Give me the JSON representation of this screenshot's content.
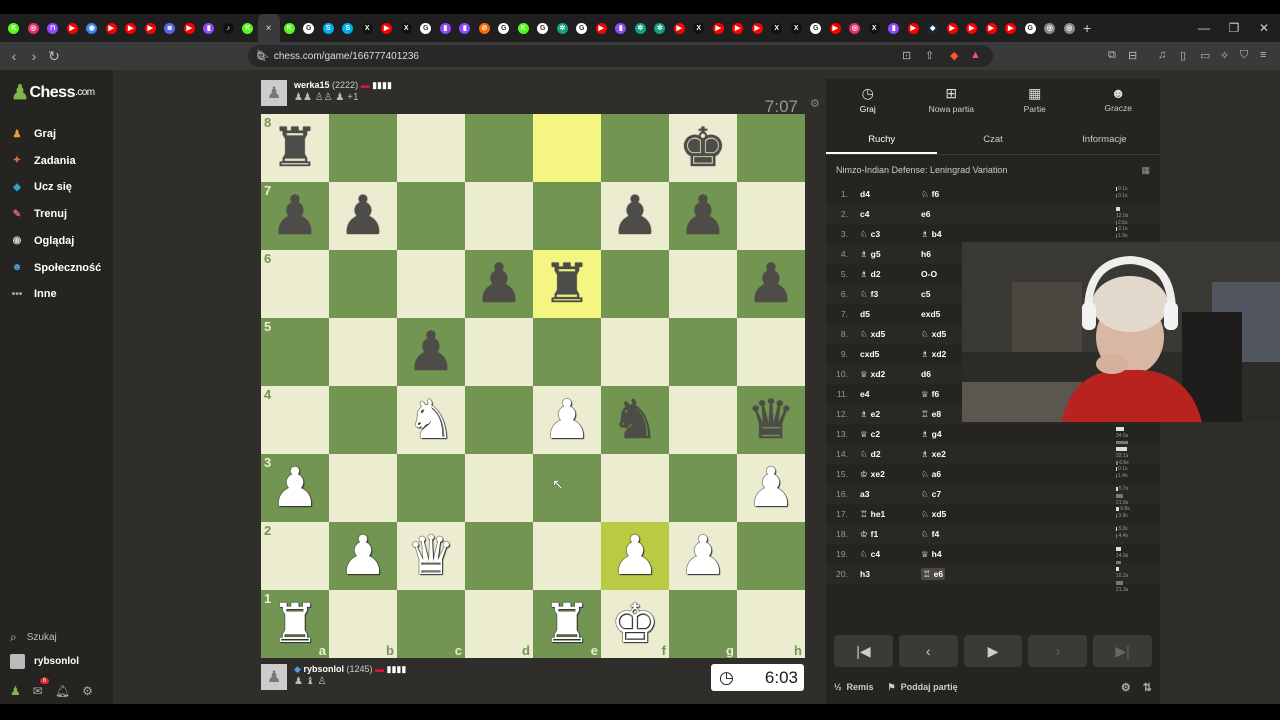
{
  "browser": {
    "url": "chess.com/game/166777401236",
    "tab_favicons": [
      {
        "icon": "kick-icon",
        "color": "#53fc18",
        "glyph": "K"
      },
      {
        "icon": "instagram-icon",
        "color": "#e1306c",
        "glyph": "◎"
      },
      {
        "icon": "twitch-icon",
        "color": "#9146ff",
        "glyph": "⊓"
      },
      {
        "icon": "youtube-icon",
        "color": "#ff0000",
        "glyph": "▶"
      },
      {
        "icon": "site-icon",
        "color": "#3b82f6",
        "glyph": "◉"
      },
      {
        "icon": "youtube-icon",
        "color": "#ff0000",
        "glyph": "▶"
      },
      {
        "icon": "youtube-icon",
        "color": "#ff0000",
        "glyph": "▶"
      },
      {
        "icon": "youtube-icon",
        "color": "#ff0000",
        "glyph": "▶"
      },
      {
        "icon": "discord-icon",
        "color": "#5865f2",
        "glyph": "◙"
      },
      {
        "icon": "youtube-icon",
        "color": "#ff0000",
        "glyph": "▶"
      },
      {
        "icon": "twitch-icon",
        "color": "#9146ff",
        "glyph": "▮"
      },
      {
        "icon": "tiktok-icon",
        "color": "#111111",
        "glyph": "♪"
      },
      {
        "icon": "kick-icon",
        "color": "#53fc18",
        "glyph": "K"
      },
      {
        "icon": "close-icon",
        "color": "",
        "glyph": "×"
      },
      {
        "icon": "kick-icon",
        "color": "#53fc18",
        "glyph": "K"
      },
      {
        "icon": "google-icon",
        "color": "#ffffff",
        "glyph": "G"
      },
      {
        "icon": "skype-icon",
        "color": "#00aff0",
        "glyph": "S"
      },
      {
        "icon": "skype-icon",
        "color": "#00aff0",
        "glyph": "S"
      },
      {
        "icon": "x-icon",
        "color": "#111111",
        "glyph": "X"
      },
      {
        "icon": "youtube-icon",
        "color": "#ff0000",
        "glyph": "▶"
      },
      {
        "icon": "x-icon",
        "color": "#111111",
        "glyph": "X"
      },
      {
        "icon": "google-icon",
        "color": "#ffffff",
        "glyph": "G"
      },
      {
        "icon": "twitch-icon",
        "color": "#9146ff",
        "glyph": "▮"
      },
      {
        "icon": "twitch-icon",
        "color": "#9146ff",
        "glyph": "▮"
      },
      {
        "icon": "bookmark-icon",
        "color": "#ff6a00",
        "glyph": "⊘"
      },
      {
        "icon": "google-icon",
        "color": "#ffffff",
        "glyph": "G"
      },
      {
        "icon": "kick-icon",
        "color": "#53fc18",
        "glyph": "K"
      },
      {
        "icon": "google-icon",
        "color": "#ffffff",
        "glyph": "G"
      },
      {
        "icon": "chatgpt-icon",
        "color": "#10a37f",
        "glyph": "✲"
      },
      {
        "icon": "google-icon",
        "color": "#ffffff",
        "glyph": "G"
      },
      {
        "icon": "youtube-icon",
        "color": "#ff0000",
        "glyph": "▶"
      },
      {
        "icon": "twitch-icon",
        "color": "#9146ff",
        "glyph": "▮"
      },
      {
        "icon": "chatgpt-icon",
        "color": "#10a37f",
        "glyph": "✲"
      },
      {
        "icon": "chatgpt-icon",
        "color": "#10a37f",
        "glyph": "✲"
      },
      {
        "icon": "youtube-icon",
        "color": "#ff0000",
        "glyph": "▶"
      },
      {
        "icon": "x-icon",
        "color": "#111111",
        "glyph": "X"
      },
      {
        "icon": "youtube-icon",
        "color": "#ff0000",
        "glyph": "▶"
      },
      {
        "icon": "youtube-icon",
        "color": "#ff0000",
        "glyph": "▶"
      },
      {
        "icon": "youtube-icon",
        "color": "#ff0000",
        "glyph": "▶"
      },
      {
        "icon": "x-icon",
        "color": "#111111",
        "glyph": "X"
      },
      {
        "icon": "x-icon",
        "color": "#111111",
        "glyph": "X"
      },
      {
        "icon": "google-icon",
        "color": "#ffffff",
        "glyph": "G"
      },
      {
        "icon": "youtube-icon",
        "color": "#ff0000",
        "glyph": "▶"
      },
      {
        "icon": "instagram-icon",
        "color": "#e1306c",
        "glyph": "◎"
      },
      {
        "icon": "x-icon",
        "color": "#111111",
        "glyph": "X"
      },
      {
        "icon": "twitch-icon",
        "color": "#9146ff",
        "glyph": "▮"
      },
      {
        "icon": "youtube-icon",
        "color": "#ff0000",
        "glyph": "▶"
      },
      {
        "icon": "steam-icon",
        "color": "#1b2838",
        "glyph": "◆"
      },
      {
        "icon": "youtube-icon",
        "color": "#ff0000",
        "glyph": "▶"
      },
      {
        "icon": "youtube-icon",
        "color": "#ff0000",
        "glyph": "▶"
      },
      {
        "icon": "youtube-icon",
        "color": "#ff0000",
        "glyph": "▶"
      },
      {
        "icon": "youtube-icon",
        "color": "#ff0000",
        "glyph": "▶"
      },
      {
        "icon": "google-icon",
        "color": "#ffffff",
        "glyph": "G"
      },
      {
        "icon": "globe-icon",
        "color": "#888888",
        "glyph": "◎"
      },
      {
        "icon": "globe-icon",
        "color": "#888888",
        "glyph": "◎"
      }
    ]
  },
  "sidebar": {
    "logo_text": "Chess",
    "logo_suffix": ".com",
    "items": [
      {
        "label": "Graj",
        "icon": "play-icon",
        "color": "#e2a03f"
      },
      {
        "label": "Zadania",
        "icon": "puzzle-icon",
        "color": "#e66b3a"
      },
      {
        "label": "Ucz się",
        "icon": "learn-icon",
        "color": "#2f9fd1"
      },
      {
        "label": "Trenuj",
        "icon": "train-icon",
        "color": "#d46a6a"
      },
      {
        "label": "Oglądaj",
        "icon": "watch-icon",
        "color": "#cccccc"
      },
      {
        "label": "Społeczność",
        "icon": "community-icon",
        "color": "#4aa3df"
      },
      {
        "label": "Inne",
        "icon": "more-icon",
        "color": "#aaaaaa"
      }
    ],
    "search_label": "Szukaj",
    "username": "rybsonlol",
    "notification_count": "8"
  },
  "game": {
    "top_player": {
      "name": "werka15",
      "rating": "(2222)",
      "captured": "♟♟ ♙♙ ♟ +1"
    },
    "top_clock": "7:07",
    "bottom_player": {
      "name": "rybsonlol",
      "rating": "(1245)",
      "captured": "♟ ♝ ♙"
    },
    "bottom_clock": "6:03",
    "board": [
      [
        "r",
        "",
        "",
        "",
        "",
        "",
        "k",
        ""
      ],
      [
        "p",
        "p",
        "",
        "",
        "",
        "p",
        "p",
        ""
      ],
      [
        "",
        "",
        "",
        "p",
        "r",
        "",
        "",
        "p"
      ],
      [
        "",
        "",
        "p",
        "",
        "",
        "",
        "",
        ""
      ],
      [
        "",
        "",
        "N",
        "",
        "P",
        "n",
        "",
        "q"
      ],
      [
        "P",
        "",
        "",
        "",
        "",
        "",
        "",
        "P"
      ],
      [
        "",
        "P",
        "Q",
        "",
        "",
        "P",
        "P",
        ""
      ],
      [
        "R",
        "",
        "",
        "",
        "R",
        "K",
        "",
        ""
      ]
    ],
    "highlight_squares": [
      "e8",
      "e6"
    ],
    "highlight_dark_squares": [
      "f2"
    ],
    "ranks": [
      "8",
      "7",
      "6",
      "5",
      "4",
      "3",
      "2",
      "1"
    ],
    "files": [
      "a",
      "b",
      "c",
      "d",
      "e",
      "f",
      "g",
      "h"
    ]
  },
  "panel": {
    "nav": [
      {
        "label": "Graj",
        "icon": "clock-icon"
      },
      {
        "label": "Nowa partia",
        "icon": "plus-icon"
      },
      {
        "label": "Partie",
        "icon": "board-icon"
      },
      {
        "label": "Gracze",
        "icon": "players-icon"
      }
    ],
    "tabs": [
      "Ruchy",
      "Czat",
      "Informacje"
    ],
    "opening": "Nimzo-Indian Defense: Leningrad Variation",
    "moves": [
      {
        "n": "1.",
        "w": "d4",
        "b": "f6",
        "wp": "",
        "bp": "♘"
      },
      {
        "n": "2.",
        "w": "c4",
        "b": "e6",
        "wp": "",
        "bp": ""
      },
      {
        "n": "3.",
        "w": "c3",
        "b": "b4",
        "wp": "♘",
        "bp": "♗"
      },
      {
        "n": "4.",
        "w": "g5",
        "b": "h6",
        "wp": "♗",
        "bp": ""
      },
      {
        "n": "5.",
        "w": "d2",
        "b": "O-O",
        "wp": "♗",
        "bp": ""
      },
      {
        "n": "6.",
        "w": "f3",
        "b": "c5",
        "wp": "♘",
        "bp": ""
      },
      {
        "n": "7.",
        "w": "d5",
        "b": "exd5",
        "wp": "",
        "bp": ""
      },
      {
        "n": "8.",
        "w": "xd5",
        "b": "xd5",
        "wp": "♘",
        "bp": "♘"
      },
      {
        "n": "9.",
        "w": "cxd5",
        "b": "xd2",
        "wp": "",
        "bp": "♗"
      },
      {
        "n": "10.",
        "w": "xd2",
        "b": "d6",
        "wp": "♕",
        "bp": ""
      },
      {
        "n": "11.",
        "w": "e4",
        "b": "f6",
        "wp": "",
        "bp": "♕"
      },
      {
        "n": "12.",
        "w": "e2",
        "b": "e8",
        "wp": "♗",
        "bp": "♖"
      },
      {
        "n": "13.",
        "w": "c2",
        "b": "g4",
        "wp": "♕",
        "bp": "♗"
      },
      {
        "n": "14.",
        "w": "d2",
        "b": "xe2",
        "wp": "♘",
        "bp": "♗"
      },
      {
        "n": "15.",
        "w": "xe2",
        "b": "a6",
        "wp": "♔",
        "bp": "♘"
      },
      {
        "n": "16.",
        "w": "a3",
        "b": "c7",
        "wp": "",
        "bp": "♘"
      },
      {
        "n": "17.",
        "w": "he1",
        "b": "xd5",
        "wp": "♖",
        "bp": "♘"
      },
      {
        "n": "18.",
        "w": "f1",
        "b": "f4",
        "wp": "♔",
        "bp": "♘"
      },
      {
        "n": "19.",
        "w": "c4",
        "b": "h4",
        "wp": "♘",
        "bp": "♕"
      },
      {
        "n": "20.",
        "w": "h3",
        "b": "e6",
        "wp": "",
        "bp": "♖"
      }
    ],
    "times": [
      [
        "0.1s",
        "0.1s"
      ],
      [
        "12.0s",
        "2.6s"
      ],
      [
        "3.1s",
        "1.9s"
      ],
      [
        "",
        ""
      ],
      [
        "",
        ""
      ],
      [
        "",
        ""
      ],
      [
        "",
        ""
      ],
      [
        "",
        ""
      ],
      [
        "",
        ""
      ],
      [
        "",
        ""
      ],
      [
        "",
        ""
      ],
      [
        "",
        ""
      ],
      [
        "24.5s",
        "37.5s"
      ],
      [
        "33.1s",
        "6.6s"
      ],
      [
        "0.1s",
        "1.4s"
      ],
      [
        "5.7s",
        "21.9s"
      ],
      [
        "9.8s",
        "3.9s"
      ],
      [
        "3.3s",
        "4.4s"
      ],
      [
        "14.9s",
        "15.1s"
      ],
      [
        "10.2s",
        "21.3s"
      ]
    ],
    "draw_label": "Remis",
    "resign_label": "Poddaj partię"
  }
}
